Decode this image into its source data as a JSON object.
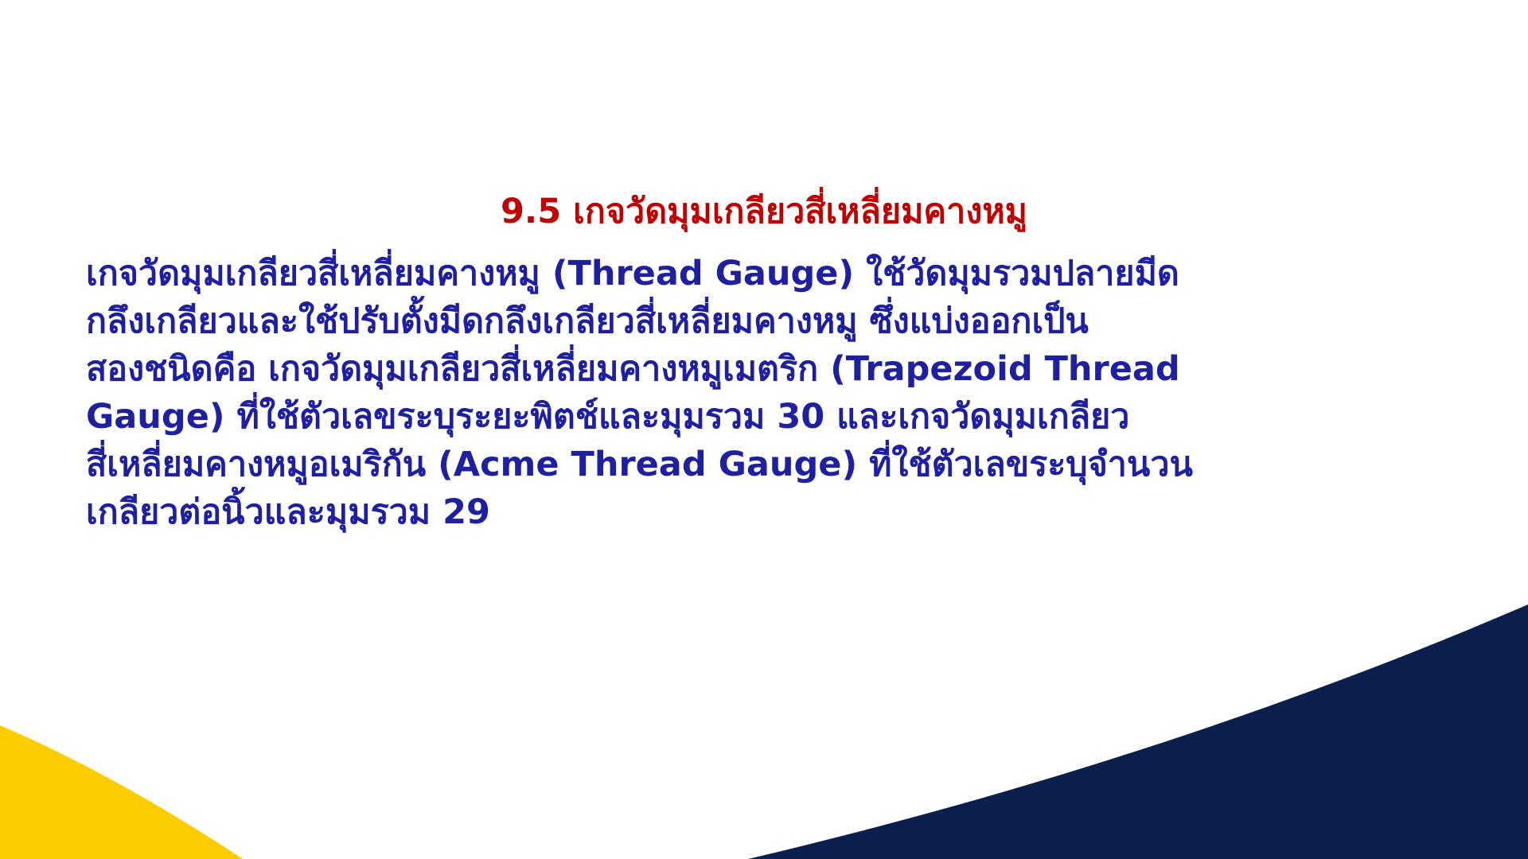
{
  "slide": {
    "title": "9.5 เกจวัดมุมเกลียวสี่เหลี่ยมคางหมู",
    "paragraph_lines": [
      "เกจวัดมุมเกลียวสี่เหลี่ยมคางหมู (Thread Gauge) ใช้วัดมุมรวมปลายมีด",
      "กลึงเกลียวและใช้ปรับตั้งมีดกลึงเกลียวสี่เหลี่ยมคางหมู ซึ่งแบ่งออกเป็น",
      "สองชนิดคือ เกจวัดมุมเกลียวสี่เหลี่ยมคางหมูเมตริก (Trapezoid Thread",
      "Gauge) ที่ใช้ตัวเลขระบุระยะพิตช์และมุมรวม 30 และเกจวัดมุมเกลียว",
      "สี่เหลี่ยมคางหมูอเมริกัน (Acme Thread Gauge) ที่ใช้ตัวเลขระบุจำนวน",
      "เกลียวต่อนิ้วและมุมรวม 29"
    ]
  },
  "colors": {
    "title": "#c00000",
    "body": "#1f1fa3",
    "navy_shape": "#0b1f4f",
    "yellow_shape": "#ffcc00",
    "background": "#ffffff"
  }
}
